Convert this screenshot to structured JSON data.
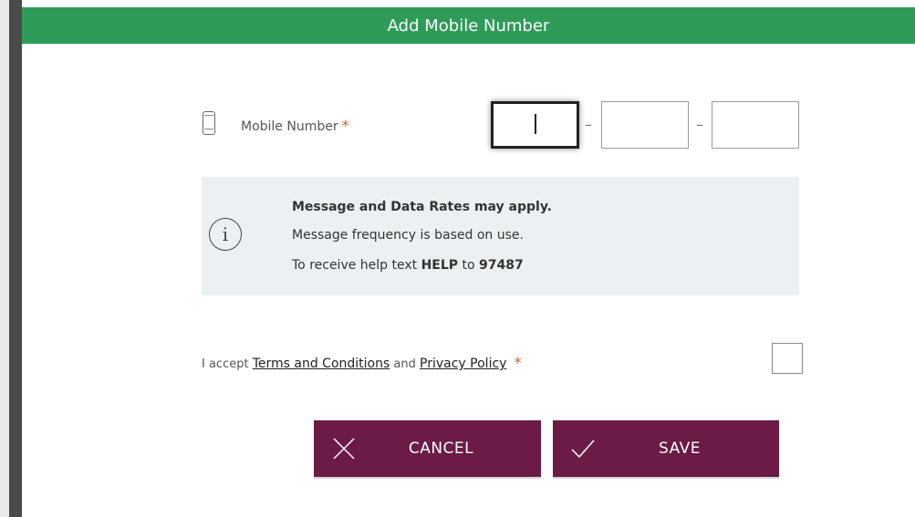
{
  "modal": {
    "title": "Add Mobile Number"
  },
  "mobile": {
    "label": "Mobile Number",
    "required_mark": "*",
    "part1_value": "",
    "part2_value": "",
    "part3_value": "",
    "separator": "–"
  },
  "info": {
    "icon": "info-icon",
    "line1": "Message and Data Rates may apply.",
    "line2": "Message frequency is based on use.",
    "line3_prefix": "To receive help text ",
    "line3_keyword": "HELP",
    "line3_mid": " to ",
    "line3_number": "97487"
  },
  "terms": {
    "prefix": "I accept ",
    "terms_link": "Terms and Conditions",
    "and_text": " and ",
    "privacy_link": "Privacy Policy",
    "required_mark": "*",
    "checked": false
  },
  "buttons": {
    "cancel_label": "CANCEL",
    "cancel_icon": "close-icon",
    "save_label": "SAVE",
    "save_icon": "check-icon"
  },
  "colors": {
    "header": "#2e9c58",
    "button": "#6c1a46",
    "info_bg": "#ecf0f3",
    "required": "#e05a2b"
  }
}
